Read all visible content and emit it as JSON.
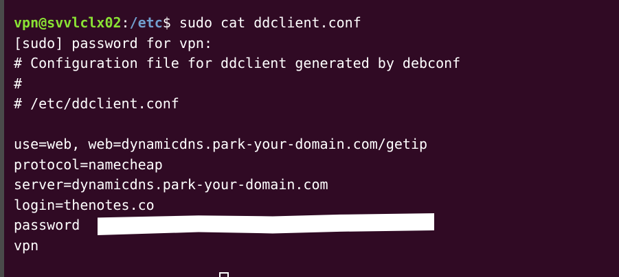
{
  "prompt": {
    "user_host": "vpn@svvlclx02",
    "colon": ":",
    "path": "/etc",
    "symbol": "$",
    "command": " sudo cat ddclient.conf"
  },
  "output_lines": [
    "[sudo] password for vpn:",
    "# Configuration file for ddclient generated by debconf",
    "#",
    "# /etc/ddclient.conf",
    "",
    "use=web, web=dynamicdns.park-your-domain.com/getip",
    "protocol=namecheap",
    "server=dynamicdns.park-your-domain.com",
    "login=thenotes.co",
    "password",
    "vpn"
  ],
  "colors": {
    "background": "#300a24",
    "prompt_user": "#8ae234",
    "prompt_path": "#729fcf",
    "text": "#ffffff"
  }
}
